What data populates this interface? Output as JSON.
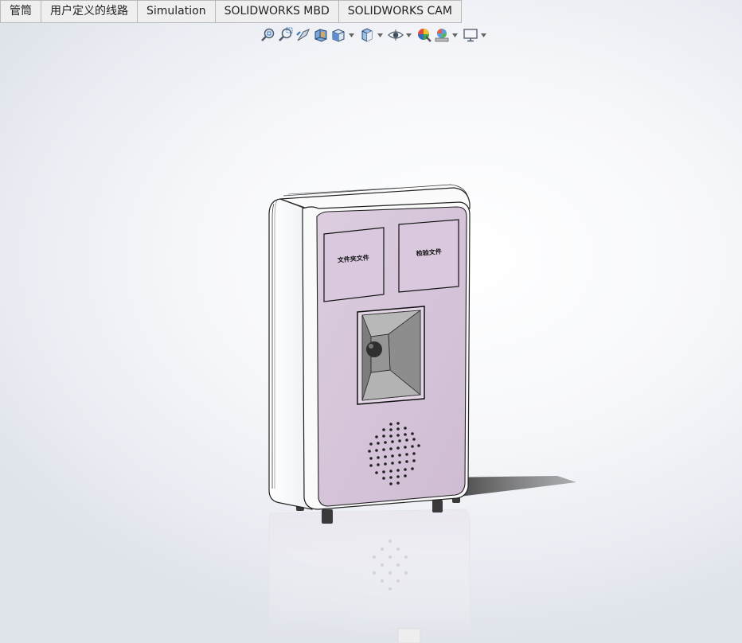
{
  "tabs": [
    {
      "label": "管筒"
    },
    {
      "label": "用户定义的线路"
    },
    {
      "label": "Simulation"
    },
    {
      "label": "SOLIDWORKS MBD"
    },
    {
      "label": "SOLIDWORKS CAM"
    }
  ],
  "toolbar": {
    "tools": [
      {
        "icon": "zoom-to-fit-icon"
      },
      {
        "icon": "zoom-to-area-icon"
      },
      {
        "icon": "previous-view-icon"
      },
      {
        "icon": "section-view-icon"
      },
      {
        "icon": "view-orientation-icon"
      },
      {
        "icon": "display-style-icon"
      },
      {
        "icon": "hide-show-items-icon"
      },
      {
        "icon": "edit-appearance-icon"
      },
      {
        "icon": "apply-scene-icon"
      },
      {
        "icon": "view-settings-icon"
      }
    ]
  },
  "model": {
    "panel_left_text": "文件夹文件",
    "panel_right_text": "检验文件",
    "body_color": "#d8c8dc",
    "shell_color": "#ffffff"
  },
  "colors": {
    "tab_border": "#b9b9b9",
    "viewport_center": "#ffffff",
    "viewport_edge": "#dfe3ea"
  }
}
